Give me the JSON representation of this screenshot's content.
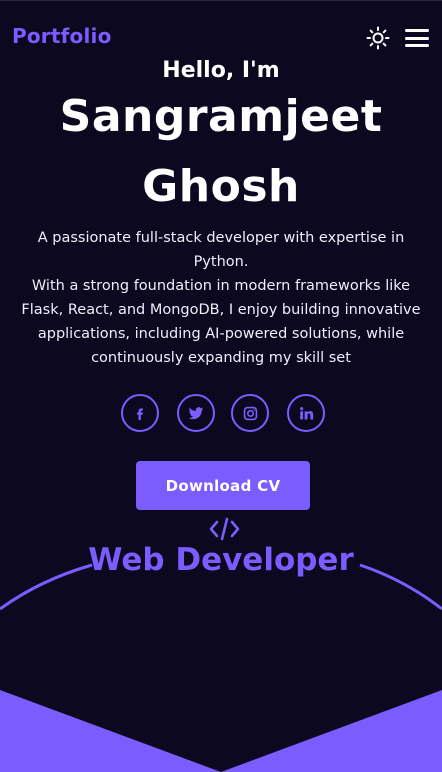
{
  "header": {
    "logo": "Portfolio",
    "theme_toggle_icon": "sun-icon",
    "menu_icon": "hamburger-menu-icon"
  },
  "hero": {
    "greeting": "Hello, I'm",
    "name_line1": "Sangramjeet",
    "name_line2": "Ghosh",
    "bio_line1": "A passionate full-stack developer with expertise in",
    "bio_line2": "Python.",
    "bio_line3": "With a strong foundation in modern frameworks like",
    "bio_line4": "Flask, React, and MongoDB, I enjoy building innovative",
    "bio_line5": "applications, including AI-powered solutions, while",
    "bio_line6": "continuously expanding my skill set"
  },
  "socials": [
    {
      "icon": "facebook-icon"
    },
    {
      "icon": "twitter-icon"
    },
    {
      "icon": "instagram-icon"
    },
    {
      "icon": "linkedin-icon"
    }
  ],
  "cta": {
    "download_cv_label": "Download CV"
  },
  "role": {
    "icon": "code-icon",
    "title": "Web Developer"
  },
  "colors": {
    "accent": "#7b5cff",
    "background": "#0b0820",
    "text": "#ffffff"
  }
}
